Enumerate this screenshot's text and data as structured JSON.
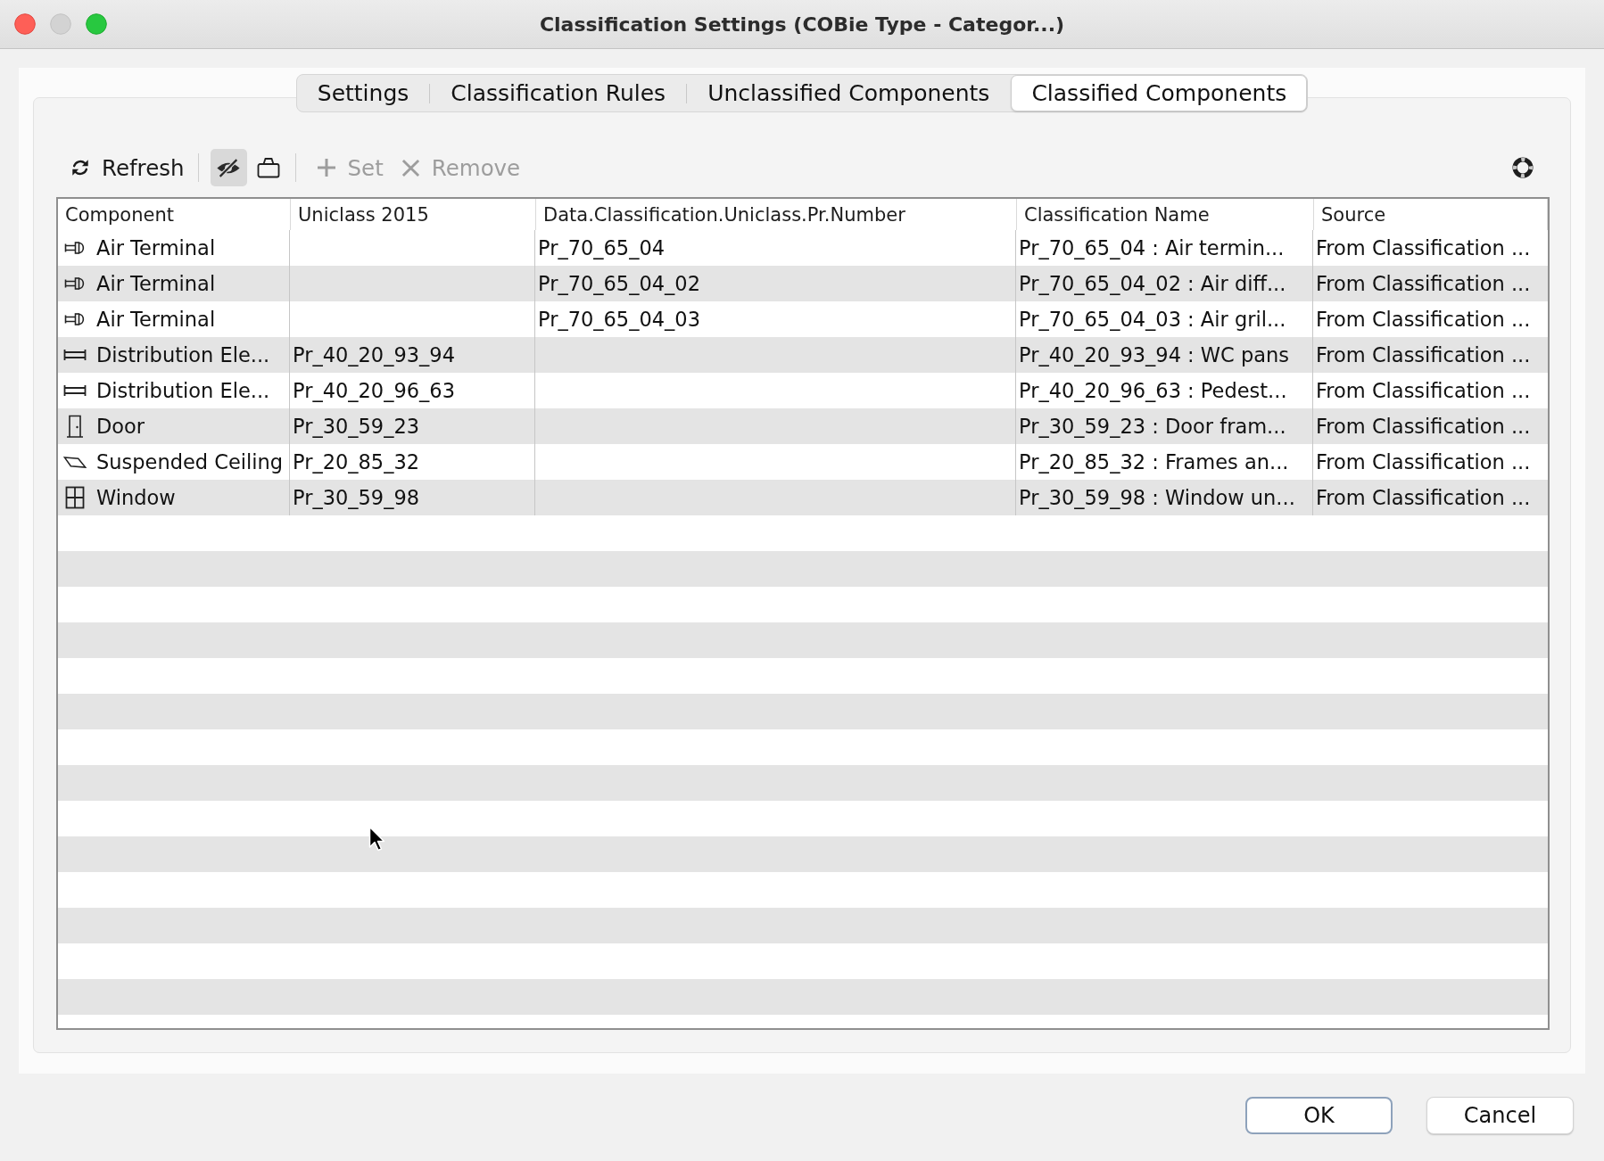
{
  "window": {
    "title": "Classification Settings (COBie Type - Categor...)"
  },
  "tabs": [
    {
      "label": "Settings",
      "selected": false
    },
    {
      "label": "Classification Rules",
      "selected": false
    },
    {
      "label": "Unclassified Components",
      "selected": false
    },
    {
      "label": "Classified Components",
      "selected": true
    }
  ],
  "toolbar": {
    "refresh": {
      "label": "Refresh",
      "disabled": false
    },
    "toggles": [
      {
        "on": true
      },
      {
        "on": false
      }
    ],
    "set": {
      "label": "Set",
      "disabled": true
    },
    "remove": {
      "label": "Remove",
      "disabled": true
    }
  },
  "table": {
    "columns": [
      "Component",
      "Uniclass 2015",
      "Data.Classification.Uniclass.Pr.Number",
      "Classification Name",
      "Source"
    ],
    "rows": [
      {
        "kind": "air_terminal",
        "selected": false,
        "component": "Air Terminal",
        "pr_number": "Pr_70_65_04",
        "classification_name": "Pr_70_65_04 : Air termin...",
        "source": "From Classification ..."
      },
      {
        "kind": "air_terminal",
        "selected": false,
        "component": "Air Terminal",
        "pr_number": "Pr_70_65_04_02",
        "classification_name": "Pr_70_65_04_02 : Air diff...",
        "source": "From Classification ..."
      },
      {
        "kind": "air_terminal",
        "selected": false,
        "component": "Air Terminal",
        "pr_number": "Pr_70_65_04_03",
        "classification_name": "Pr_70_65_04_03 : Air gril...",
        "source": "From Classification ..."
      },
      {
        "kind": "distribution",
        "selected": false,
        "component": "Distribution Ele...",
        "uniclass_2015": "Pr_40_20_93_94",
        "classification_name": "Pr_40_20_93_94 : WC pans",
        "source": "From Classification ..."
      },
      {
        "kind": "distribution",
        "selected": false,
        "component": "Distribution Ele...",
        "uniclass_2015": "Pr_40_20_96_63",
        "classification_name": "Pr_40_20_96_63 : Pedest...",
        "source": "From Classification ..."
      },
      {
        "kind": "door",
        "selected": false,
        "component": "Door",
        "uniclass_2015": "Pr_30_59_23",
        "classification_name": "Pr_30_59_23 : Door fram...",
        "source": "From Classification ..."
      },
      {
        "kind": "ceiling",
        "selected": false,
        "component": "Suspended Ceiling",
        "uniclass_2015": "Pr_20_85_32",
        "classification_name": "Pr_20_85_32 : Frames an...",
        "source": "From Classification ..."
      },
      {
        "kind": "window",
        "selected": false,
        "component": "Window",
        "uniclass_2015": "Pr_30_59_98",
        "classification_name": "Pr_30_59_98 : Window un...",
        "source": "From Classification ..."
      }
    ]
  },
  "buttons": [
    {
      "label": "OK",
      "default": true
    },
    {
      "label": "Cancel",
      "default": false
    }
  ]
}
